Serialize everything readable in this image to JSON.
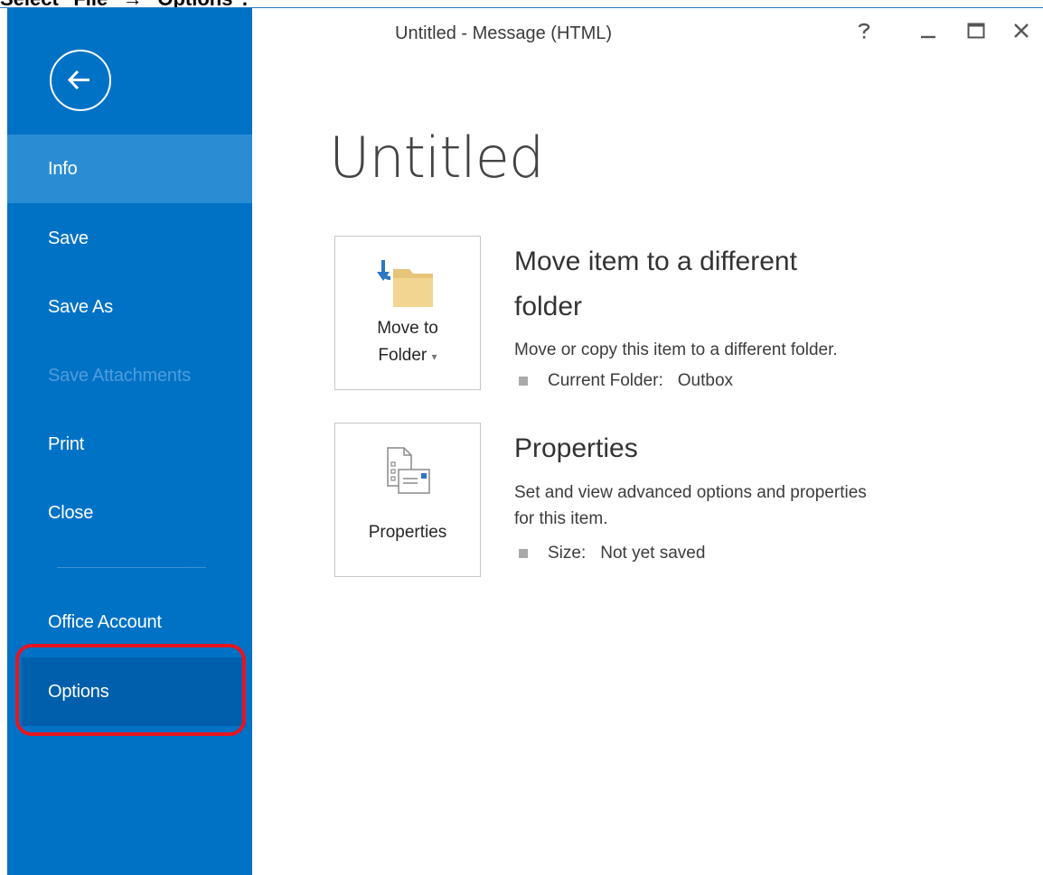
{
  "caption": "Select \"File\" → \"Options\".",
  "window": {
    "title": "Untitled - Message (HTML)",
    "controls": [
      "help-icon",
      "minimize-icon",
      "maximize-icon",
      "close-icon"
    ]
  },
  "sidebar": {
    "back_icon": "back-arrow-icon",
    "items": [
      {
        "label": "Info"
      },
      {
        "label": "Save"
      },
      {
        "label": "Save As"
      },
      {
        "label": "Save Attachments"
      },
      {
        "label": "Print"
      },
      {
        "label": "Close"
      },
      {
        "label": "Office Account"
      },
      {
        "label": "Options"
      }
    ]
  },
  "main": {
    "title": "Untitled",
    "move": {
      "button_line1": "Move to",
      "button_line2": "Folder",
      "dropdown_glyph": "▾",
      "heading_line1": "Move item to a different",
      "heading_line2": "folder",
      "description": "Move or copy this item to a different folder.",
      "detail_key": "Current Folder:",
      "detail_value": "Outbox"
    },
    "properties": {
      "button_label": "Properties",
      "heading": "Properties",
      "description_line1": "Set and view advanced options and properties",
      "description_line2": "for this item.",
      "detail_key": "Size:",
      "detail_value": "Not yet saved"
    }
  },
  "colors": {
    "sidebar": "#0072c6",
    "sidebar_active": "#2a8dd4",
    "highlight": "#e8141f"
  }
}
